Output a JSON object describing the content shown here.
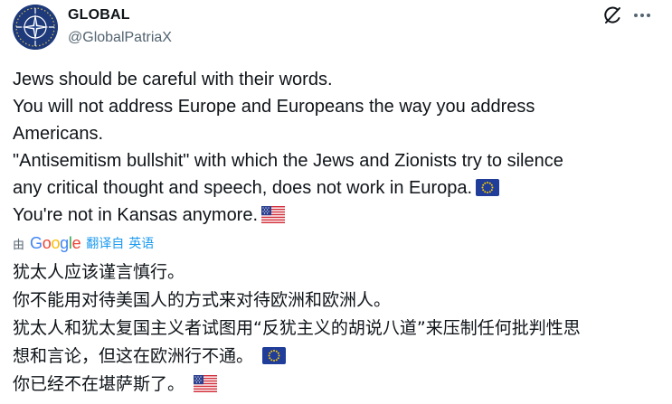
{
  "author": {
    "name": "GLOBAL",
    "handle": "@GlobalPatriaX",
    "avatar_icon": "nato-star-avatar-icon"
  },
  "header_actions": {
    "grok_icon": "grok-icon",
    "more_icon": "more-icon"
  },
  "original": {
    "line1": "Jews should be careful with their words.",
    "line2": "You will not address Europe and Europeans the way you address",
    "line3": "Americans.",
    "line4": "\"Antisemitism bullshit\" with which the Jews and Zionists try to silence",
    "line5": "any critical thought and speech, does not work in Europa.",
    "line5_flag": "eu-flag-icon",
    "line6": "You're not in Kansas anymore.",
    "line6_flag": "us-flag-icon"
  },
  "translation": {
    "by_label": "由",
    "provider": "Google",
    "link_part1": "翻译自",
    "link_part2": "英语"
  },
  "translated": {
    "line1": "犹太人应该谨言慎行。",
    "line2": "你不能用对待美国人的方式来对待欧洲和欧洲人。",
    "line3": "犹太人和犹太复国主义者试图用“反犹主义的胡说八道”来压制任何批判性思",
    "line4": "想和言论，但这在欧洲行不通。",
    "line4_flag": "eu-flag-icon",
    "line5": "你已经不在堪萨斯了。",
    "line5_flag": "us-flag-icon"
  },
  "colors": {
    "text": "#0f1419",
    "secondary": "#536471",
    "link": "#1d9bf0",
    "avatar_bg": "#1e3a7a",
    "eu_blue": "#1f3d99",
    "eu_gold": "#ffcc00"
  }
}
